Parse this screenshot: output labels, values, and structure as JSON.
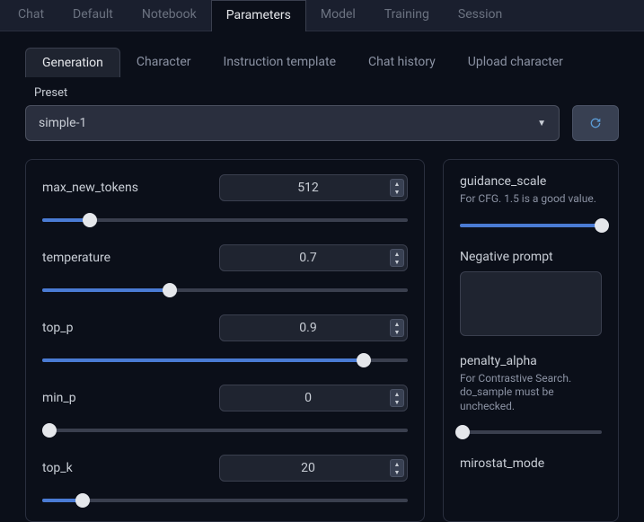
{
  "top_tabs": {
    "items": [
      "Chat",
      "Default",
      "Notebook",
      "Parameters",
      "Model",
      "Training",
      "Session"
    ],
    "active": "Parameters"
  },
  "sub_tabs": {
    "items": [
      "Generation",
      "Character",
      "Instruction template",
      "Chat history",
      "Upload character"
    ],
    "active": "Generation"
  },
  "preset": {
    "label": "Preset",
    "value": "simple-1"
  },
  "params_left": [
    {
      "name": "max_new_tokens",
      "value": "512",
      "pct": 13
    },
    {
      "name": "temperature",
      "value": "0.7",
      "pct": 35
    },
    {
      "name": "top_p",
      "value": "0.9",
      "pct": 88
    },
    {
      "name": "min_p",
      "value": "0",
      "pct": 2
    },
    {
      "name": "top_k",
      "value": "20",
      "pct": 11
    }
  ],
  "params_right": {
    "guidance_scale": {
      "label": "guidance_scale",
      "desc": "For CFG. 1.5 is a good value.",
      "pct": 100
    },
    "neg_prompt": {
      "label": "Negative prompt",
      "value": ""
    },
    "penalty_alpha": {
      "label": "penalty_alpha",
      "desc": "For Contrastive Search. do_sample must be unchecked.",
      "pct": 2
    },
    "mirostat": {
      "label": "mirostat_mode"
    }
  }
}
